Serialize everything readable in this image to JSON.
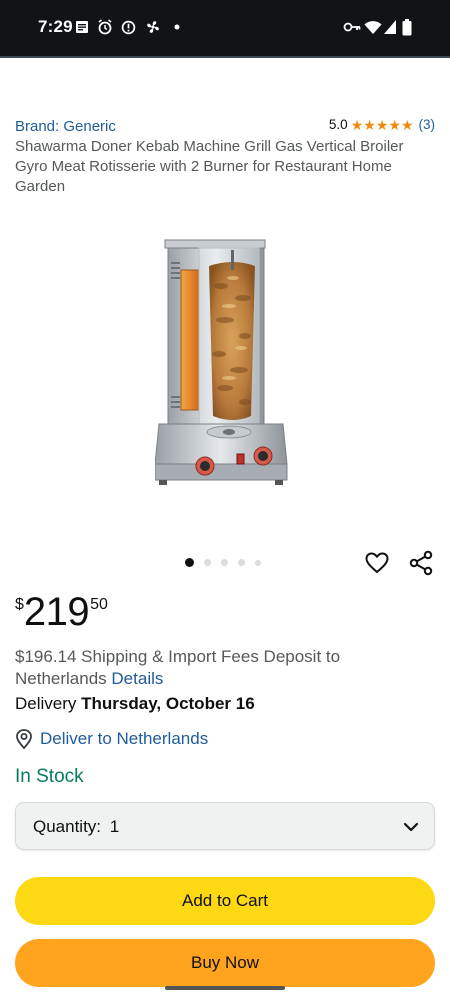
{
  "status_bar": {
    "time": "7:29",
    "left_icons": [
      "notes-icon",
      "alarm-icon",
      "alert-icon",
      "fan-icon",
      "dot-icon"
    ],
    "right_icons": [
      "vpn-key-icon",
      "wifi-icon",
      "cell-signal-icon",
      "battery-icon"
    ]
  },
  "product": {
    "brand": "Brand: Generic",
    "rating": "5.0",
    "stars": 5,
    "rating_count": "(3)",
    "title": "Shawarma Doner Kebab Machine Grill Gas Vertical Broiler Gyro Meat Rotisserie with 2 Burner for Restaurant Home Garden",
    "image": "shawarma-machine-image",
    "carousel": {
      "total": 5,
      "active": 1
    }
  },
  "price": {
    "symbol": "$",
    "whole": "219",
    "fraction": "50"
  },
  "shipping": {
    "text": "$196.14 Shipping & Import Fees Deposit to Netherlands",
    "details_link": "Details"
  },
  "delivery": {
    "label": "Delivery",
    "date": "Thursday, October 16"
  },
  "deliver_to": "Deliver to Netherlands",
  "stock": "In Stock",
  "quantity": {
    "label": "Quantity:",
    "value": "1"
  },
  "buttons": {
    "add_to_cart": "Add to Cart",
    "buy_now": "Buy Now"
  },
  "colors": {
    "link": "#1f5c99",
    "star": "#f08a0c",
    "in_stock": "#067d62",
    "add_to_cart": "#ffd814",
    "buy_now": "#ffa41c",
    "status_bar": "#111417"
  }
}
